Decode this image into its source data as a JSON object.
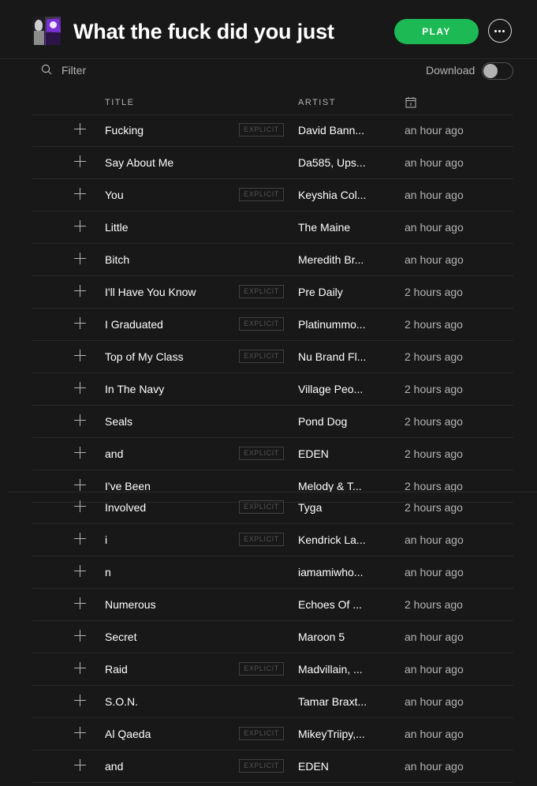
{
  "header": {
    "title": "What the fuck did you just",
    "play_label": "PLAY",
    "more_label": "More"
  },
  "toolbar": {
    "filter_placeholder": "Filter",
    "download_label": "Download",
    "download_enabled": false
  },
  "columns": {
    "title": "TITLE",
    "artist": "ARTIST",
    "date_icon": "calendar-icon"
  },
  "explicit_label": "EXPLICIT",
  "tracks": [
    {
      "title": "Fucking",
      "explicit": true,
      "artist": "David Bann...",
      "added": "an hour ago"
    },
    {
      "title": "Say About Me",
      "explicit": false,
      "artist": "Da585, Ups...",
      "added": "an hour ago"
    },
    {
      "title": "You",
      "explicit": true,
      "artist": "Keyshia Col...",
      "added": "an hour ago"
    },
    {
      "title": "Little",
      "explicit": false,
      "artist": "The Maine",
      "added": "an hour ago"
    },
    {
      "title": "Bitch",
      "explicit": false,
      "artist": "Meredith Br...",
      "added": "an hour ago"
    },
    {
      "title": "I'll Have You Know",
      "explicit": true,
      "artist": "Pre Daily",
      "added": "2 hours ago"
    },
    {
      "title": "I Graduated",
      "explicit": true,
      "artist": "Platinummo...",
      "added": "2 hours ago"
    },
    {
      "title": "Top of My Class",
      "explicit": true,
      "artist": "Nu Brand Fl...",
      "added": "2 hours ago"
    },
    {
      "title": "In The Navy",
      "explicit": false,
      "artist": "Village Peo...",
      "added": "2 hours ago"
    },
    {
      "title": "Seals",
      "explicit": false,
      "artist": "Pond Dog",
      "added": "2 hours ago"
    },
    {
      "title": "and",
      "explicit": true,
      "artist": "EDEN",
      "added": "2 hours ago"
    },
    {
      "title": "I've Been",
      "explicit": false,
      "artist": "Melody & T...",
      "added": "2 hours ago"
    },
    {
      "title": "Involved",
      "explicit": true,
      "artist": "Tyga",
      "added": "2 hours ago"
    },
    {
      "title": "i",
      "explicit": true,
      "artist": "Kendrick La...",
      "added": "an hour ago"
    },
    {
      "title": "n",
      "explicit": false,
      "artist": "iamamiwho...",
      "added": "an hour ago"
    },
    {
      "title": "Numerous",
      "explicit": false,
      "artist": "Echoes Of ...",
      "added": "2 hours ago"
    },
    {
      "title": "Secret",
      "explicit": false,
      "artist": "Maroon 5",
      "added": "an hour ago"
    },
    {
      "title": "Raid",
      "explicit": true,
      "artist": "Madvillain, ...",
      "added": "an hour ago"
    },
    {
      "title": "S.O.N.",
      "explicit": false,
      "artist": "Tamar Braxt...",
      "added": "an hour ago"
    },
    {
      "title": "Al Qaeda",
      "explicit": true,
      "artist": "MikeyTriipy,...",
      "added": "an hour ago"
    },
    {
      "title": "and",
      "explicit": true,
      "artist": "EDEN",
      "added": "an hour ago"
    }
  ],
  "colors": {
    "background": "#181818",
    "accent": "#1db954",
    "muted_text": "#b3b3b3",
    "divider": "#282828"
  }
}
